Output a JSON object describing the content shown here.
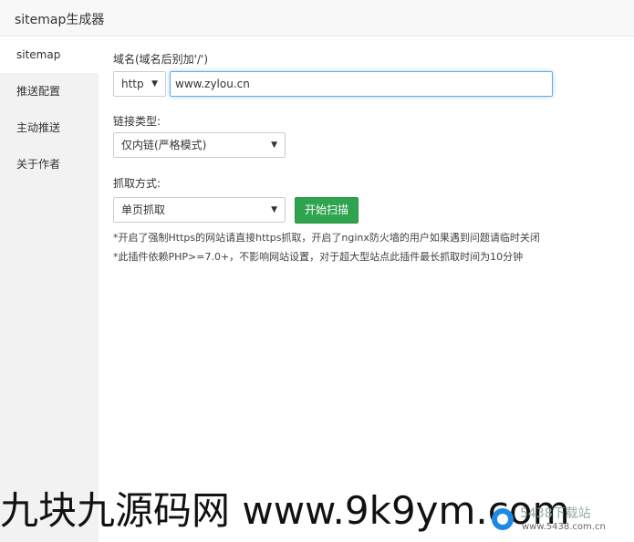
{
  "window": {
    "title": "sitemap生成器"
  },
  "sidebar": {
    "items": [
      {
        "label": "sitemap",
        "active": true
      },
      {
        "label": "推送配置",
        "active": false
      },
      {
        "label": "主动推送",
        "active": false
      },
      {
        "label": "关于作者",
        "active": false
      }
    ]
  },
  "form": {
    "domain_label": "域名(域名后别加'/')",
    "protocol_value": "http",
    "domain_value": "www.zylou.cn",
    "link_type_label": "链接类型:",
    "link_type_value": "仅内链(严格模式)",
    "crawl_mode_label": "抓取方式:",
    "crawl_mode_value": "单页抓取",
    "scan_button_label": "开始扫描"
  },
  "notes": [
    "*开启了强制Https的网站请直接https抓取，开启了nginx防火墙的用户如果遇到问题请临时关闭",
    "*此插件依赖PHP>=7.0+，不影响网站设置，对于超大型站点此插件最长抓取时间为10分钟"
  ],
  "watermark": {
    "text": "九块九源码网 www.9k9ym.com",
    "logo_text": "5438下载站",
    "logo_url": "www.5438.com.cn"
  },
  "colors": {
    "accent_green": "#2ea44f",
    "focus_blue": "#66afe9",
    "sidebar_bg": "#f2f2f2"
  }
}
